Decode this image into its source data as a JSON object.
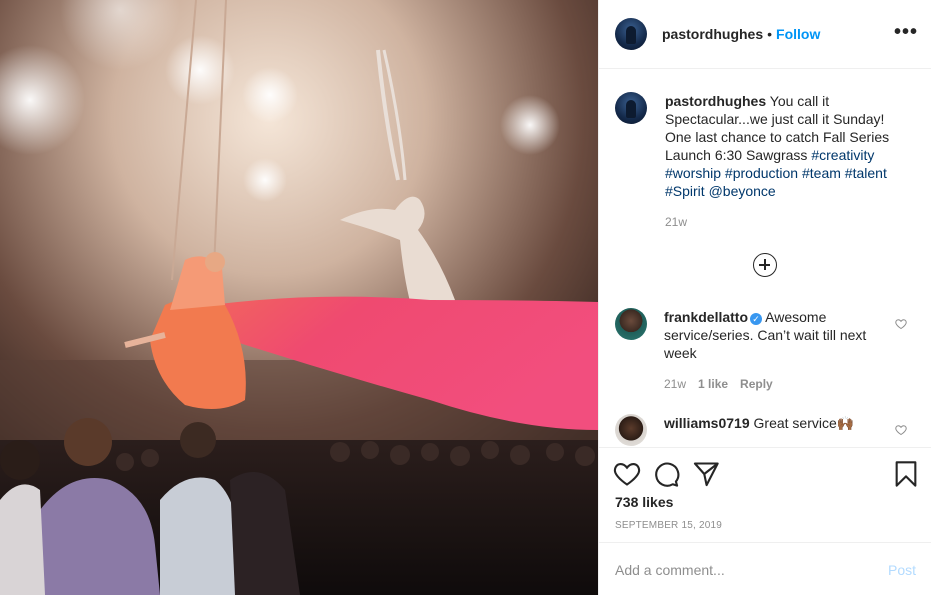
{
  "header": {
    "username": "pastordhughes",
    "separator": "•",
    "follow_label": "Follow",
    "more_icon": "more-horizontal-icon"
  },
  "caption": {
    "username": "pastordhughes",
    "text_part1": " You call it Spectacular...we just call it Sunday! One last chance to catch Fall Series Launch 6:30 Sawgrass ",
    "hashtags": [
      "#creativity",
      "#worship",
      "#production",
      "#team",
      "#talent",
      "#Spirit"
    ],
    "mention": "@beyonce",
    "age": "21w"
  },
  "comments": [
    {
      "username": "frankdellatto",
      "verified": true,
      "text": " Awesome service/series. Can’t wait till next week",
      "age": "21w",
      "likes": "1 like",
      "reply_label": "Reply"
    },
    {
      "username": "williams0719",
      "verified": false,
      "text": " Great service🙌🏾",
      "age": "",
      "likes": "",
      "reply_label": ""
    }
  ],
  "actions": {
    "like_icon": "heart-icon",
    "comment_icon": "comment-icon",
    "share_icon": "send-icon",
    "save_icon": "bookmark-icon"
  },
  "likes_count": "738 likes",
  "date": "SEPTEMBER 15, 2019",
  "add_comment": {
    "placeholder": "Add a comment...",
    "post_label": "Post"
  },
  "colors": {
    "link": "#0095f6",
    "hashtag": "#00376b",
    "muted": "#8e8e8e",
    "post_disabled": "#b3dbff",
    "fabric": "#e83a6b"
  }
}
